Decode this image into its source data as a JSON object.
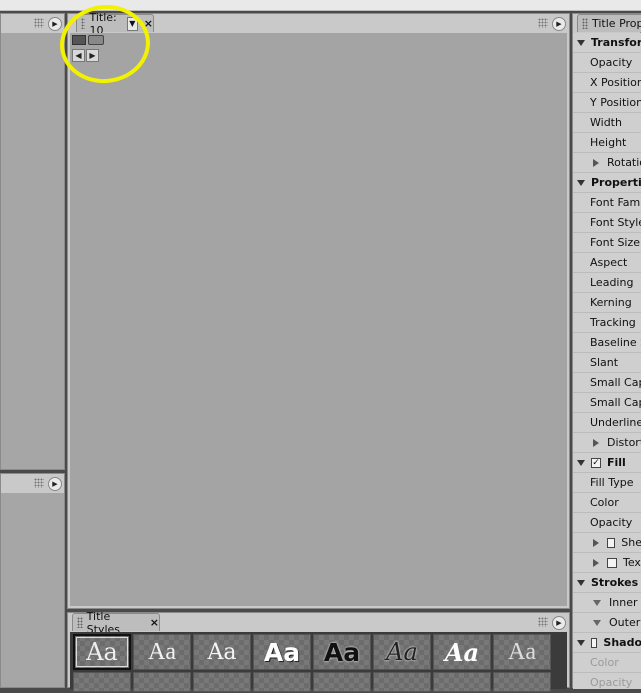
{
  "monitor": {
    "tab_label": "Title: 10",
    "close": "×"
  },
  "styles_panel": {
    "tab_label": "Title Styles",
    "close": "×",
    "swatch_row1": [
      "Aa",
      "Aa",
      "Aa",
      "Aa",
      "Aa",
      "Aa",
      "Aa",
      "Aa"
    ],
    "swatch_row2": [
      "",
      "",
      "",
      "",
      "",
      "",
      "",
      ""
    ]
  },
  "properties": {
    "tab_label": "Title Prop",
    "rows": [
      {
        "label": "Transfor",
        "kind": "group-open"
      },
      {
        "label": "Opacity",
        "kind": "item"
      },
      {
        "label": "X Position",
        "kind": "item"
      },
      {
        "label": "Y Position",
        "kind": "item"
      },
      {
        "label": "Width",
        "kind": "item"
      },
      {
        "label": "Height",
        "kind": "item"
      },
      {
        "label": "Rotatio",
        "kind": "sub-closed"
      },
      {
        "label": "Propertie",
        "kind": "group-open"
      },
      {
        "label": "Font Famil",
        "kind": "item"
      },
      {
        "label": "Font Style",
        "kind": "item"
      },
      {
        "label": "Font Size",
        "kind": "item"
      },
      {
        "label": "Aspect",
        "kind": "item"
      },
      {
        "label": "Leading",
        "kind": "item"
      },
      {
        "label": "Kerning",
        "kind": "item"
      },
      {
        "label": "Tracking",
        "kind": "item"
      },
      {
        "label": "Baseline S",
        "kind": "item"
      },
      {
        "label": "Slant",
        "kind": "item"
      },
      {
        "label": "Small Caps",
        "kind": "item"
      },
      {
        "label": "Small Caps",
        "kind": "item"
      },
      {
        "label": "Underline",
        "kind": "item"
      },
      {
        "label": "Distort",
        "kind": "sub-closed"
      },
      {
        "label": "Fill",
        "kind": "group-check"
      },
      {
        "label": "Fill Type",
        "kind": "item"
      },
      {
        "label": "Color",
        "kind": "item"
      },
      {
        "label": "Opacity",
        "kind": "item"
      },
      {
        "label": "She",
        "kind": "sub-check"
      },
      {
        "label": "Tex",
        "kind": "sub-check"
      },
      {
        "label": "Strokes",
        "kind": "group-open"
      },
      {
        "label": "Inner S",
        "kind": "sub-open"
      },
      {
        "label": "Outer S",
        "kind": "sub-open"
      },
      {
        "label": "Shado",
        "kind": "group-uncheck"
      },
      {
        "label": "Color",
        "kind": "dim"
      },
      {
        "label": "Opacity",
        "kind": "dim"
      }
    ]
  }
}
